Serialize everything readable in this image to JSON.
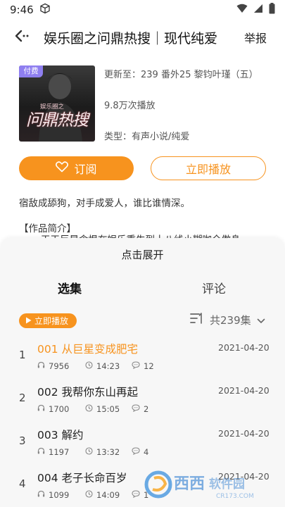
{
  "status": {
    "time": "9:46"
  },
  "header": {
    "title": "娱乐圈之问鼎热搜｜现代纯爱",
    "report_label": "举报"
  },
  "book": {
    "cover_badge": "付费",
    "cover_title": "问鼎热搜",
    "cover_subtitle": "娱乐圈之",
    "updated": "更新至：239  番外25 黎钧叶瑾（五）",
    "plays": "9.8万次播放",
    "category": "类型：有声小说/纯爱"
  },
  "actions": {
    "subscribe_label": "订阅",
    "play_label": "立即播放"
  },
  "tagline": "宿敌成舔狗，对手成爱人，谁比谁情深。",
  "intro": {
    "heading": "【作品简介】",
    "body": "天王巨星含恨在娱乐重生到十八线小糊咖全傲身"
  },
  "sheet": {
    "expand_label": "点击展开",
    "tabs": {
      "episodes": "选集",
      "comments": "评论"
    },
    "play_chip": "立即播放",
    "total": "共239集"
  },
  "episodes": [
    {
      "index": "1",
      "title": "001  从巨星变成肥宅",
      "date": "2021-04-20",
      "plays": "7956",
      "duration": "14:23",
      "comments": "12",
      "current": true
    },
    {
      "index": "2",
      "title": "002  我帮你东山再起",
      "date": "2021-04-20",
      "plays": "1700",
      "duration": "15:05",
      "comments": "2"
    },
    {
      "index": "3",
      "title": "003  解约",
      "date": "2021-04-20",
      "plays": "1197",
      "duration": "13:32",
      "comments": "4"
    },
    {
      "index": "4",
      "title": "004  老子长命百岁",
      "date": "2021-04-20",
      "plays": "1099",
      "duration": "14:09",
      "comments": "1"
    }
  ],
  "watermark": {
    "brand": "西西软件园",
    "url": "CR173.COM"
  },
  "colors": {
    "accent": "#f7931e",
    "sheet_bg": "#f7f7f7",
    "badge": "#8f7ff0"
  },
  "icons": [
    "box-icon",
    "wifi-icon",
    "signal-icon",
    "battery-icon",
    "back-icon",
    "heart-icon",
    "play-icon",
    "sort-icon",
    "chevron-down-icon",
    "headphones-icon",
    "clock-icon",
    "comment-icon"
  ]
}
